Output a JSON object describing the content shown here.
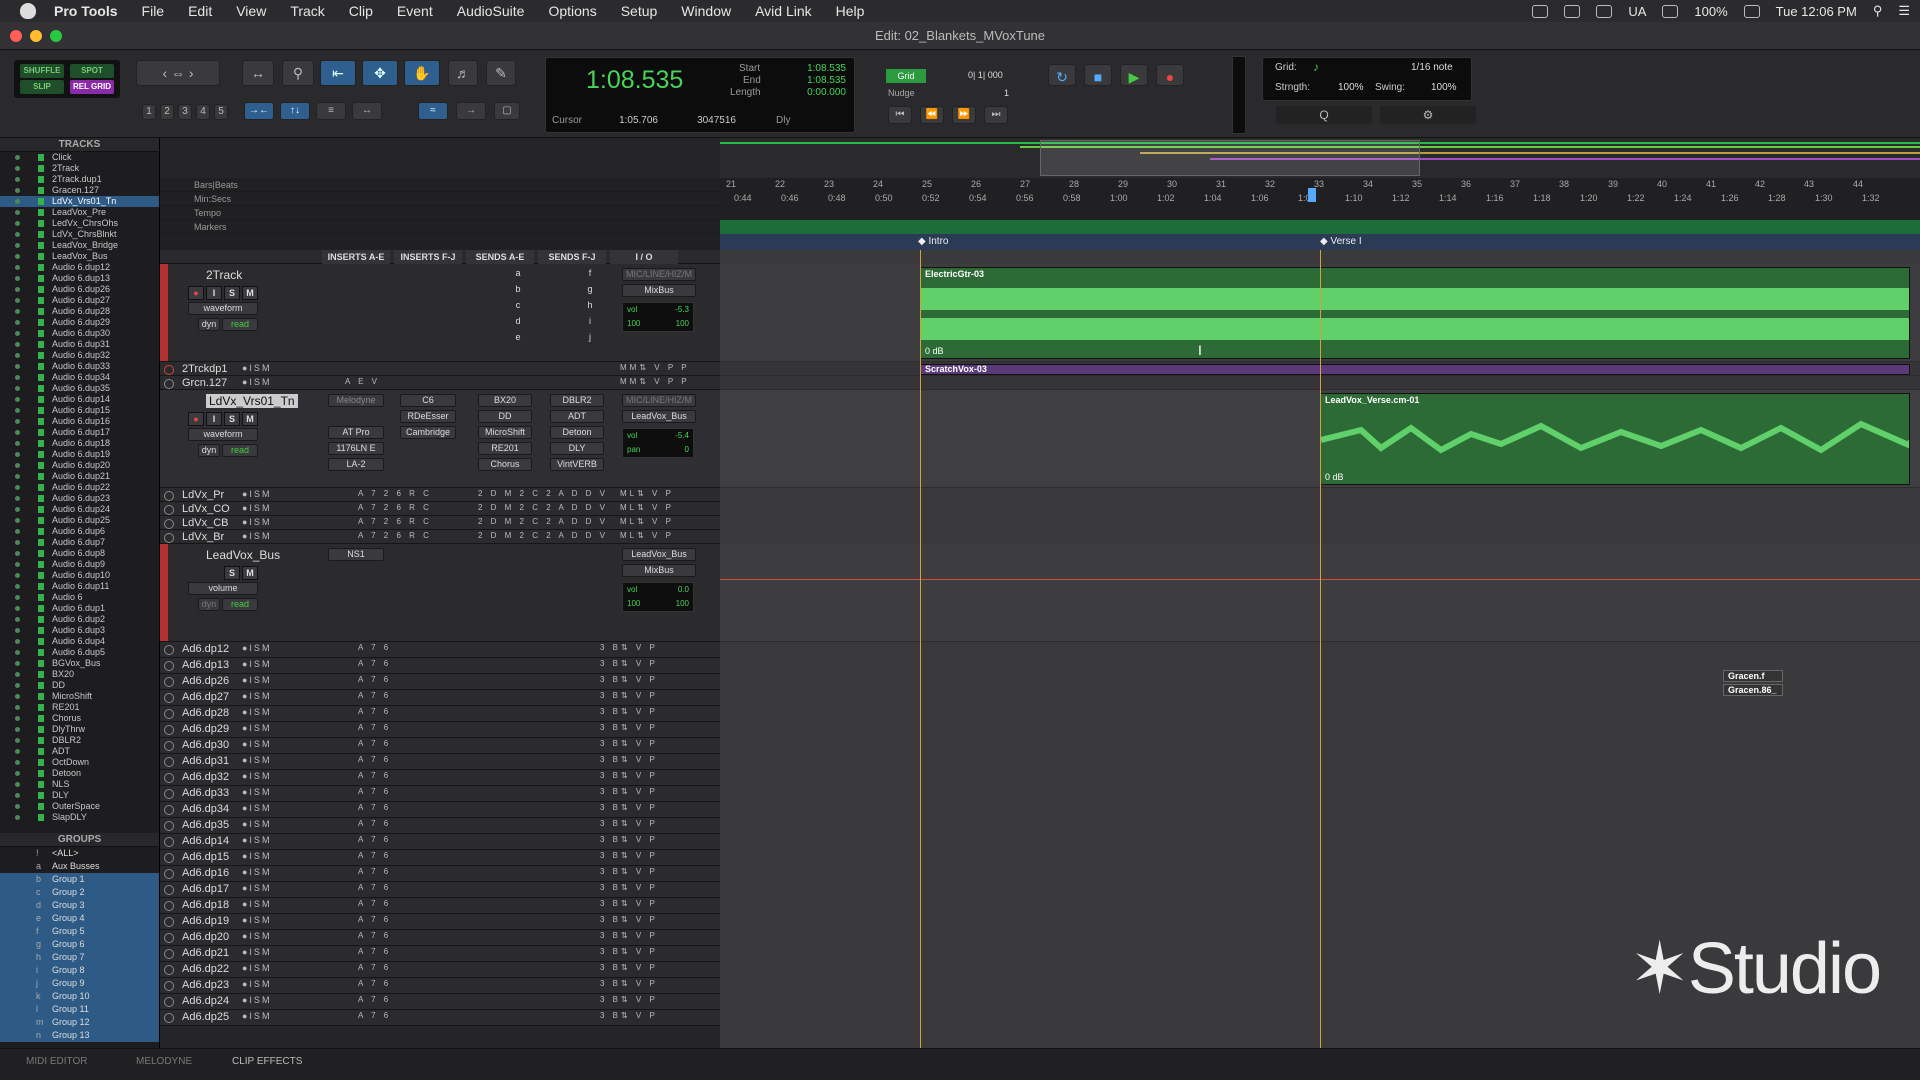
{
  "menubar": {
    "items": [
      "Pro Tools",
      "File",
      "Edit",
      "View",
      "Track",
      "Clip",
      "Event",
      "AudioSuite",
      "Options",
      "Setup",
      "Window",
      "Avid Link",
      "Help"
    ],
    "status_ua": "UA",
    "battery": "100%",
    "clock": "Tue 12:06 PM"
  },
  "window": {
    "title": "Edit: 02_Blankets_MVoxTune"
  },
  "edit_modes": {
    "shuffle": "SHUFFLE",
    "spot": "SPOT",
    "slip": "SLIP",
    "grid": "REL GRID"
  },
  "zoom_presets": [
    "1",
    "2",
    "3",
    "4",
    "5"
  ],
  "counter": {
    "main": "1:08.535",
    "start_label": "Start",
    "start": "1:08.535",
    "end_label": "End",
    "end": "1:08.535",
    "length_label": "Length",
    "length": "0:00.000",
    "cursor_label": "Cursor",
    "cursor": "1:05.706",
    "sample": "3047516",
    "dly": "Dly"
  },
  "grid_nudge": {
    "grid_btn": "Grid",
    "grid_value": "0| 1| 000",
    "nudge_label": "Nudge",
    "nudge_value": "1"
  },
  "grid_panel": {
    "label": "Grid:",
    "note": "1/16 note",
    "strength_label": "Strngth:",
    "strength": "100%",
    "swing_label": "Swing:",
    "swing": "100%"
  },
  "tracks_panel": {
    "header": "TRACKS",
    "items": [
      "Click",
      "2Track",
      "2Track.dup1",
      "Gracen.127",
      "LdVx_Vrs01_Tn",
      "LeadVox_Pre",
      "LedVx_ChrsOhs",
      "LdVx_ChrsBlnkt",
      "LeadVox_Bridge",
      "LeadVox_Bus",
      "Audio 6.dup12",
      "Audio 6.dup13",
      "Audio 6.dup26",
      "Audio 6.dup27",
      "Audio 6.dup28",
      "Audio 6.dup29",
      "Audio 6.dup30",
      "Audio 6.dup31",
      "Audio 6.dup32",
      "Audio 6.dup33",
      "Audio 6.dup34",
      "Audio 6.dup35",
      "Audio 6.dup14",
      "Audio 6.dup15",
      "Audio 6.dup16",
      "Audio 6.dup17",
      "Audio 6.dup18",
      "Audio 6.dup19",
      "Audio 6.dup20",
      "Audio 6.dup21",
      "Audio 6.dup22",
      "Audio 6.dup23",
      "Audio 6.dup24",
      "Audio 6.dup25",
      "Audio 6.dup6",
      "Audio 6.dup7",
      "Audio 6.dup8",
      "Audio 6.dup9",
      "Audio 6.dup10",
      "Audio 6.dup11",
      "Audio 6",
      "Audio 6.dup1",
      "Audio 6.dup2",
      "Audio 6.dup3",
      "Audio 6.dup4",
      "Audio 6.dup5",
      "BGVox_Bus",
      "BX20",
      "DD",
      "MicroShift",
      "RE201",
      "Chorus",
      "DlyThrw",
      "DBLR2",
      "ADT",
      "OctDown",
      "Detoon",
      "NLS",
      "DLY",
      "OuterSpace",
      "SlapDLY"
    ],
    "selected": "LdVx_Vrs01_Tn"
  },
  "groups_panel": {
    "header": "GROUPS",
    "items": [
      {
        "letter": "!",
        "name": "<ALL>"
      },
      {
        "letter": "a",
        "name": "Aux Busses"
      },
      {
        "letter": "b",
        "name": "Group 1"
      },
      {
        "letter": "c",
        "name": "Group 2"
      },
      {
        "letter": "d",
        "name": "Group 3"
      },
      {
        "letter": "e",
        "name": "Group 4"
      },
      {
        "letter": "f",
        "name": "Group 5"
      },
      {
        "letter": "g",
        "name": "Group 6"
      },
      {
        "letter": "h",
        "name": "Group 7"
      },
      {
        "letter": "i",
        "name": "Group 8"
      },
      {
        "letter": "j",
        "name": "Group 9"
      },
      {
        "letter": "k",
        "name": "Group 10"
      },
      {
        "letter": "l",
        "name": "Group 11"
      },
      {
        "letter": "m",
        "name": "Group 12"
      },
      {
        "letter": "n",
        "name": "Group 13"
      }
    ]
  },
  "rulers": {
    "bars": "Bars|Beats",
    "minsecs": "Min:Secs",
    "tempo": "Tempo",
    "markers": "Markers"
  },
  "bar_ticks": [
    "21",
    "22",
    "23",
    "24",
    "25",
    "26",
    "27",
    "28",
    "29",
    "30",
    "31",
    "32",
    "33",
    "34",
    "35",
    "36",
    "37",
    "38",
    "39",
    "40",
    "41",
    "42",
    "43",
    "44"
  ],
  "time_ticks": [
    "0:44",
    "0:46",
    "0:48",
    "0:50",
    "0:52",
    "0:54",
    "0:56",
    "0:58",
    "1:00",
    "1:02",
    "1:04",
    "1:06",
    "1:08",
    "1:10",
    "1:12",
    "1:14",
    "1:16",
    "1:18",
    "1:20",
    "1:22",
    "1:24",
    "1:26",
    "1:28",
    "1:30",
    "1:32"
  ],
  "markers": [
    "Intro",
    "Verse I"
  ],
  "columns": [
    "INSERTS A-E",
    "INSERTS F-J",
    "SENDS A-E",
    "SENDS F-J",
    "I / O"
  ],
  "track_2track": {
    "name": "2Track",
    "view": "waveform",
    "auto": "read",
    "dyn": "dyn",
    "input": "MIC/LINE/HIZ/M",
    "output": "MixBus",
    "vol": "-5.3",
    "pan_l": "100",
    "pan_r": "100",
    "sends": [
      "a",
      "b",
      "c",
      "d",
      "e"
    ],
    "sends2": [
      "f",
      "g",
      "h",
      "i",
      "j"
    ]
  },
  "small_tracks_1": [
    {
      "name": "2Trckdp1"
    },
    {
      "name": "Grcn.127"
    }
  ],
  "track_ldvx": {
    "name": "LdVx_Vrs01_Tn",
    "view": "waveform",
    "auto": "read",
    "dyn": "dyn",
    "inserts_a": [
      "Melodyne",
      "",
      "AT Pro",
      "1176LN E",
      "LA-2"
    ],
    "inserts_f": [
      "C6",
      "RDeEsser",
      "Cambridge",
      "",
      ""
    ],
    "sends_a": [
      "BX20",
      "DD",
      "MicroShift",
      "RE201",
      "Chorus"
    ],
    "sends_f": [
      "DBLR2",
      "ADT",
      "Detoon",
      "DLY",
      "VintVERB"
    ],
    "input": "MIC/LINE/HIZ/M",
    "output": "LeadVox_Bus",
    "vol": "-5.4",
    "pan": "0"
  },
  "small_tracks_2": [
    {
      "name": "LdVx_Pr"
    },
    {
      "name": "LdVx_CO"
    },
    {
      "name": "LdVx_CB"
    },
    {
      "name": "LdVx_Br"
    }
  ],
  "track_bus": {
    "name": "LeadVox_Bus",
    "view": "volume",
    "auto": "read",
    "dyn": "dyn",
    "insert": "NS1",
    "input": "LeadVox_Bus",
    "output": "MixBus",
    "vol": "0.0",
    "pan_l": "100",
    "pan_r": "100"
  },
  "small_tracks_3": [
    "Ad6.dp12",
    "Ad6.dp13",
    "Ad6.dp26",
    "Ad6.dp27",
    "Ad6.dp28",
    "Ad6.dp29",
    "Ad6.dp30",
    "Ad6.dp31",
    "Ad6.dp32",
    "Ad6.dp33",
    "Ad6.dp34",
    "Ad6.dp35",
    "Ad6.dp14",
    "Ad6.dp15",
    "Ad6.dp16",
    "Ad6.dp17",
    "Ad6.dp18",
    "Ad6.dp19",
    "Ad6.dp20",
    "Ad6.dp21",
    "Ad6.dp22",
    "Ad6.dp23",
    "Ad6.dp24",
    "Ad6.dp25"
  ],
  "regions": {
    "electric": "ElectricGtr-03",
    "scratch": "ScratchVox-03",
    "leadvox": "LeadVox_Verse.cm-01",
    "gracen1": "Gracen.f",
    "gracen2": "Gracen.86_",
    "gain": "0 dB"
  },
  "bottom_tabs": [
    "MIDI EDITOR",
    "MELODYNE",
    "CLIP EFFECTS"
  ],
  "watermark": "Studio",
  "colors": {
    "accent": "#2e5b86",
    "counter": "#49d35a",
    "region": "#2c6a36",
    "marker_line": "#d9a03a"
  }
}
